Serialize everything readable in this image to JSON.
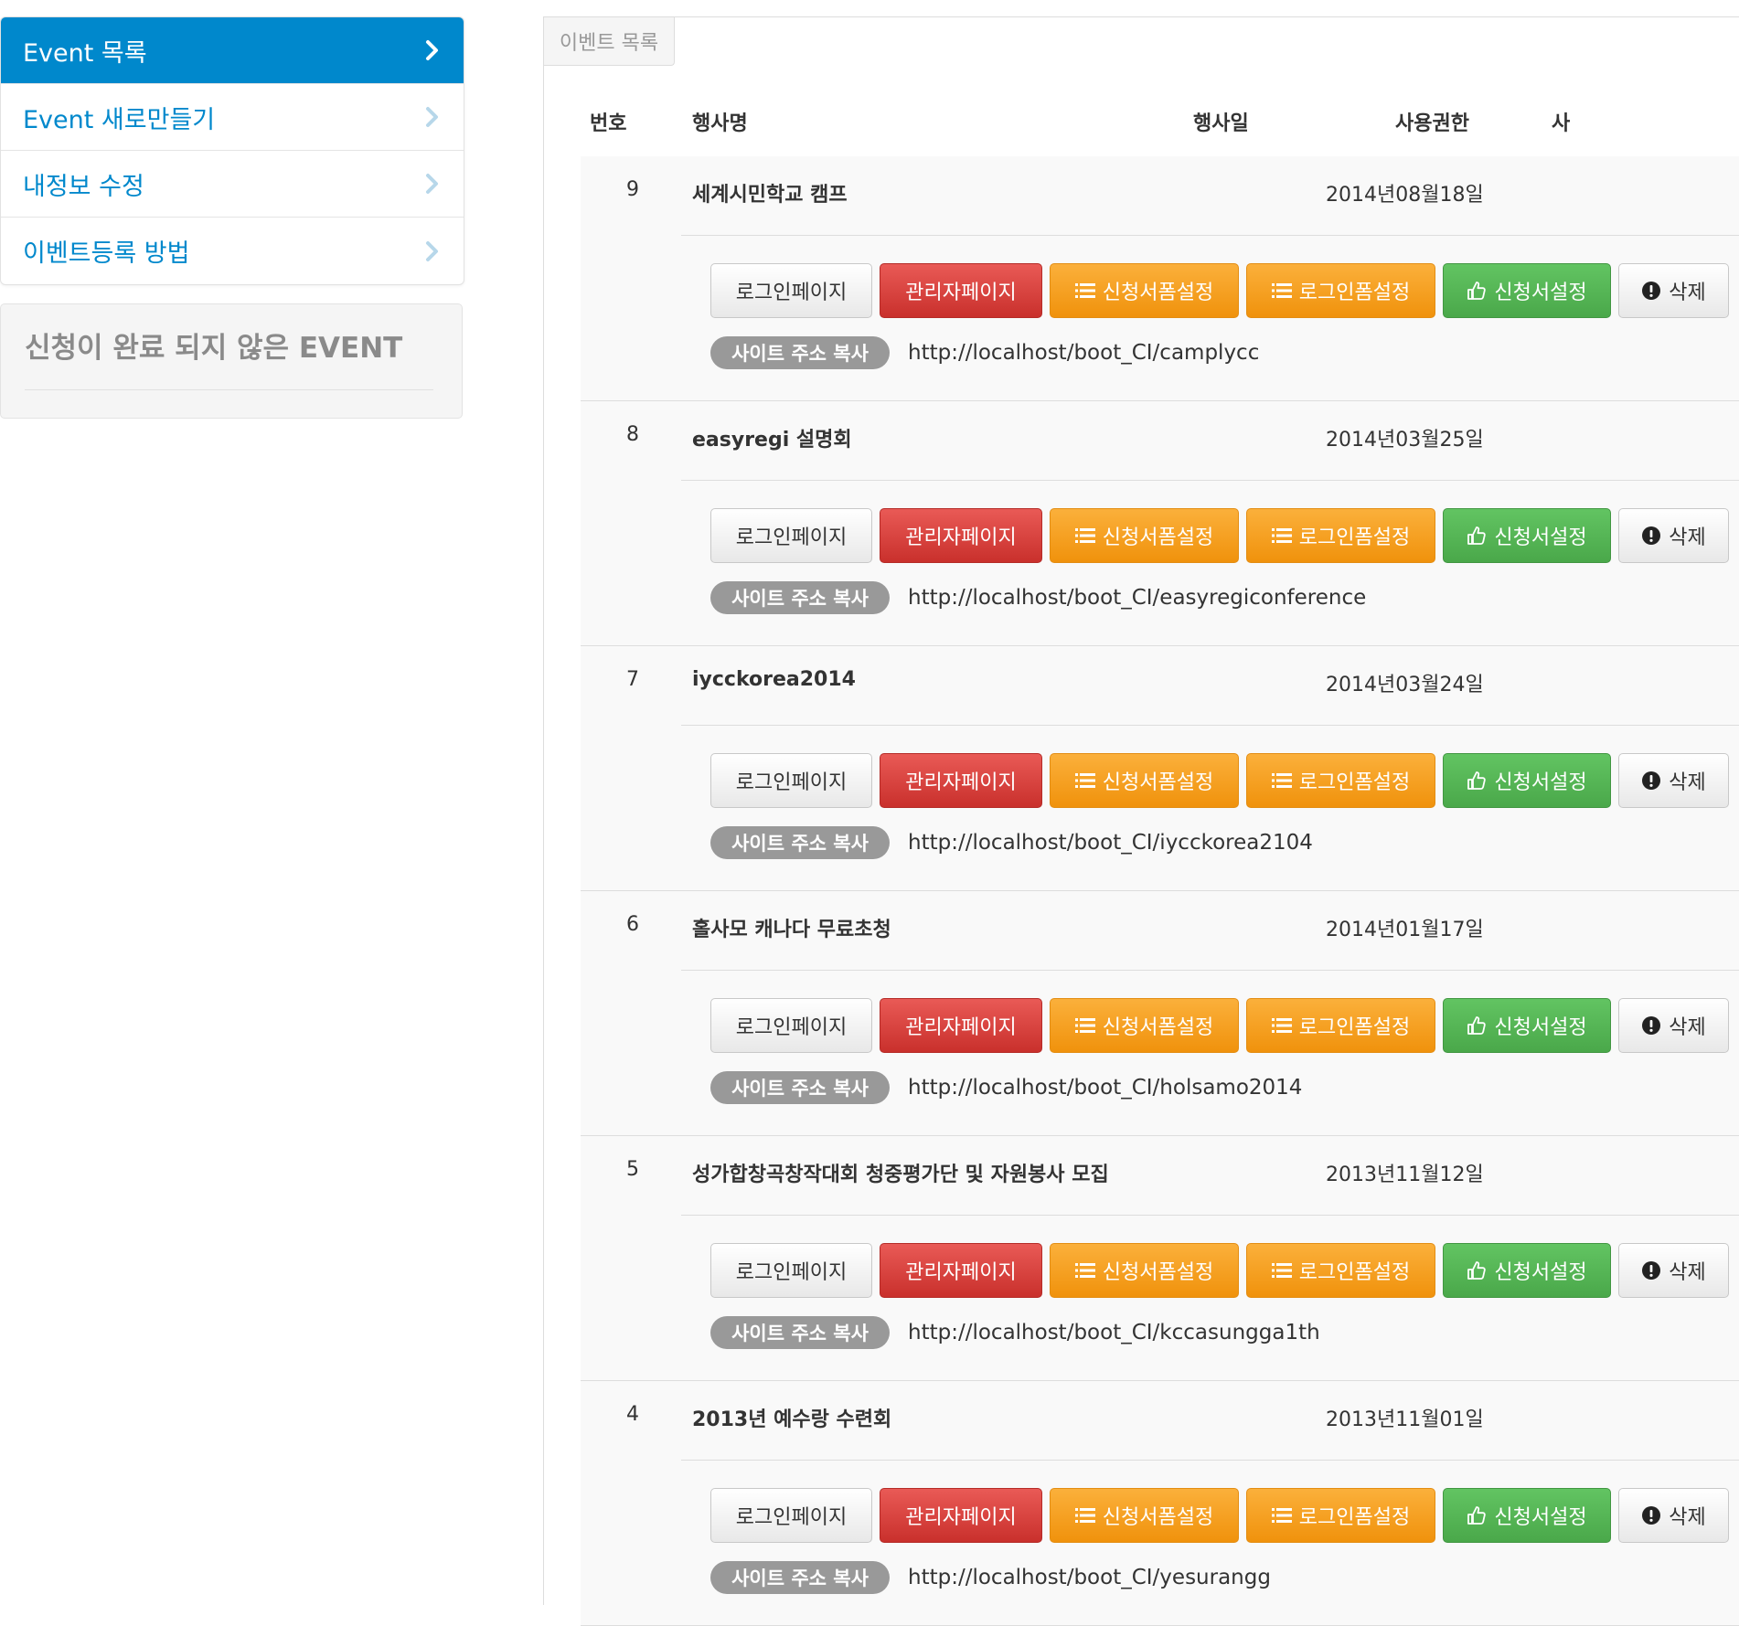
{
  "sidebar": {
    "items": [
      {
        "label": "Event 목록",
        "active": true
      },
      {
        "label": "Event 새로만들기",
        "active": false
      },
      {
        "label": "내정보 수정",
        "active": false
      },
      {
        "label": "이벤트등록 방법",
        "active": false
      }
    ],
    "incomplete_title": "신청이 완료 되지 않은 EVENT"
  },
  "panel": {
    "tab_label": "이벤트 목록",
    "columns": {
      "no": "번호",
      "name": "행사명",
      "date": "행사일",
      "permission": "사용권한",
      "extra": "사"
    }
  },
  "buttons": {
    "login_page": "로그인페이지",
    "admin_page": "관리자페이지",
    "form_setting": "신청서폼설정",
    "login_form_setting": "로그인폼설정",
    "application_setting": "신청서설정",
    "delete": "삭제",
    "copy_url": "사이트 주소 복사"
  },
  "events": [
    {
      "no": "9",
      "name": "세계시민학교 캠프",
      "date": "2014년08월18일",
      "url": "http://localhost/boot_CI/camplycc"
    },
    {
      "no": "8",
      "name": "easyregi 설명회",
      "date": "2014년03월25일",
      "url": "http://localhost/boot_CI/easyregiconference"
    },
    {
      "no": "7",
      "name": "iycckorea2014",
      "date": "2014년03월24일",
      "url": "http://localhost/boot_CI/iycckorea2104"
    },
    {
      "no": "6",
      "name": "홀사모 캐나다 무료초청",
      "date": "2014년01월17일",
      "url": "http://localhost/boot_CI/holsamo2014"
    },
    {
      "no": "5",
      "name": "성가합창곡창작대회 청중평가단 및 자원봉사 모집",
      "date": "2013년11월12일",
      "url": "http://localhost/boot_CI/kccasungga1th"
    },
    {
      "no": "4",
      "name": "2013년 예수랑 수련회",
      "date": "2013년11월01일",
      "url": "http://localhost/boot_CI/yesurangg"
    }
  ]
}
